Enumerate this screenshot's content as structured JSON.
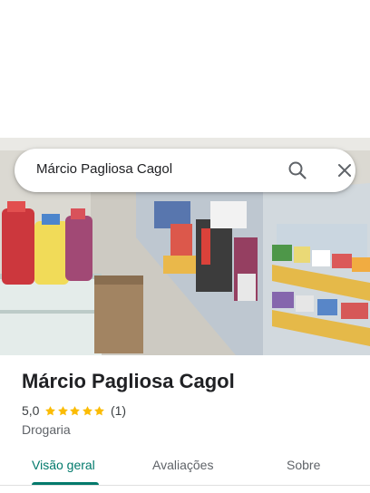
{
  "search": {
    "query": "Márcio Pagliosa Cagol"
  },
  "place": {
    "name": "Márcio Pagliosa Cagol",
    "rating_value": "5,0",
    "rating_stars": 5,
    "review_count": "(1)",
    "category": "Drogaria"
  },
  "tabs": [
    {
      "label": "Visão geral",
      "active": true
    },
    {
      "label": "Avaliações",
      "active": false
    },
    {
      "label": "Sobre",
      "active": false
    }
  ],
  "colors": {
    "accent": "#00796b",
    "star": "#fbbc04"
  },
  "icons": {
    "search": "search-icon",
    "close": "close-icon"
  }
}
